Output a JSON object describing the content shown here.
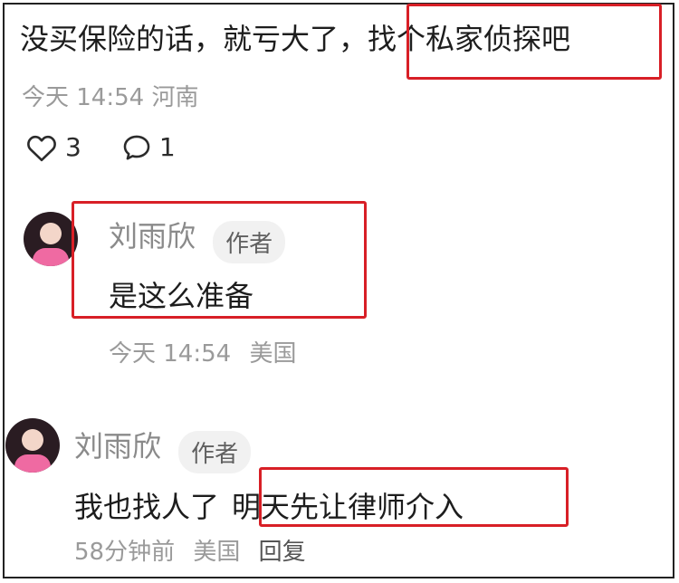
{
  "comment": {
    "text_prefix": "没买保险的话，就亏大了，",
    "text_highlight": "找个私家侦探吧",
    "time": "今天 14:54",
    "location": "河南",
    "likes": "3",
    "replies": "1"
  },
  "reply1": {
    "author": "刘雨欣",
    "badge": "作者",
    "text": "是这么准备",
    "time": "今天 14:54",
    "location": "美国"
  },
  "reply2": {
    "author": "刘雨欣",
    "badge": "作者",
    "text_prefix": "我也找人了",
    "text_highlight": "明天先让律师介入",
    "time": "58分钟前",
    "location": "美国",
    "reply_label": "回复"
  },
  "colors": {
    "highlight_box": "#d81f26",
    "meta_text": "#9a9a9a"
  },
  "icons": {
    "like": "heart-outline-icon",
    "comment": "speech-bubble-icon"
  }
}
